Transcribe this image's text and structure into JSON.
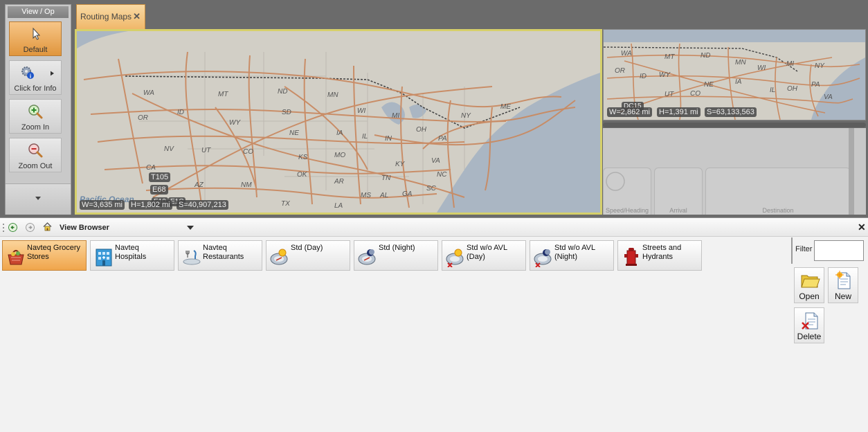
{
  "tool_panel": {
    "title": "View / Op",
    "buttons": [
      {
        "label": "Default",
        "icon": "cursor-arrow-icon",
        "active": true
      },
      {
        "label": "Click for Info",
        "icon": "info-gears-icon"
      },
      {
        "label": "Zoom In",
        "icon": "zoom-in-icon"
      },
      {
        "label": "Zoom Out",
        "icon": "zoom-out-icon"
      }
    ]
  },
  "tabs": [
    {
      "label": "Routing Maps",
      "close": "✕"
    }
  ],
  "main_map": {
    "ocean_label": "Pacific Ocean",
    "route_labels": [
      "T105",
      "E68",
      "E10",
      "E1C"
    ],
    "measurements": {
      "width": "W=3,635 mi",
      "height": "H=1,802 mi",
      "scale": "S=40,907,213"
    },
    "states": [
      "WA",
      "OR",
      "ID",
      "MT",
      "ND",
      "SD",
      "WY",
      "NE",
      "NV",
      "CA",
      "UT",
      "CO",
      "KS",
      "MO",
      "AZ",
      "NM",
      "OK",
      "AR",
      "TX",
      "LA",
      "IL",
      "IN",
      "OH",
      "PA",
      "NY",
      "ME",
      "MI",
      "WI",
      "MN",
      "IA",
      "KY",
      "TN",
      "VA",
      "NC",
      "SC",
      "GA",
      "AL",
      "MS"
    ]
  },
  "side_map": {
    "route_label": "DC15",
    "measurements": {
      "width": "W=2,862 mi",
      "height": "H=1,391 mi",
      "scale": "S=63,133,563"
    }
  },
  "dashboard_labels": [
    "Speed/Heading",
    "Arrival",
    "Destination"
  ],
  "view_browser": {
    "title": "View Browser",
    "close": "✕",
    "items": [
      {
        "label": "Navteq Grocery Stores",
        "icon": "grocery-basket-icon",
        "selected": true
      },
      {
        "label": "Navteq Hospitals",
        "icon": "hospital-building-icon"
      },
      {
        "label": "Navteq Restaurants",
        "icon": "restaurant-icon"
      },
      {
        "label": "Std (Day)",
        "icon": "sun-globe-icon"
      },
      {
        "label": "Std (Night)",
        "icon": "moon-globe-icon"
      },
      {
        "label": "Std w/o AVL (Day)",
        "icon": "sun-globe-noavl-icon"
      },
      {
        "label": "Std w/o AVL (Night)",
        "icon": "moon-globe-noavl-icon"
      },
      {
        "label": "Streets and Hydrants",
        "icon": "fire-hydrant-icon"
      }
    ],
    "filter_label": "Filter",
    "filter_value": "",
    "actions": [
      {
        "label": "Open",
        "icon": "folder-open-icon"
      },
      {
        "label": "New",
        "icon": "new-document-icon"
      },
      {
        "label": "Delete",
        "icon": "delete-document-icon"
      }
    ]
  },
  "colors": {
    "accent": "#f0a54b",
    "map_highlight": "#d6d06a",
    "roads": "#c98a62",
    "land": "#d2cfc6",
    "water": "#aab6c3"
  }
}
